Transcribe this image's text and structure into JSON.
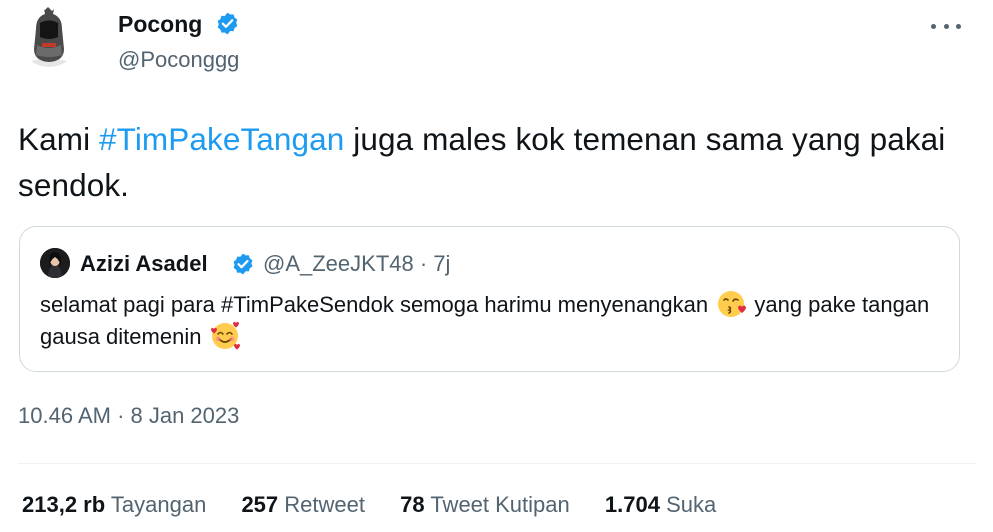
{
  "author": {
    "name": "Pocong",
    "handle": "@Poconggg",
    "avatar_icon": "pocong-avatar-icon",
    "verified_icon": "verified-badge-icon"
  },
  "menu": {
    "more_icon": "more-options-icon"
  },
  "tweet": {
    "text_before": "Kami ",
    "hashtag": "#TimPakeTangan",
    "text_after": " juga males kok temenan sama yang pakai sendok."
  },
  "quoted_tweet": {
    "name": "Azizi Asadel",
    "handle": "@A_ZeeJKT48 · 7j",
    "text_part1": "selamat pagi para #TimPakeSendok semoga harimu menyenangkan ",
    "text_part2": " yang pake tangan gausa ditemenin ",
    "emoji1": "face-blowing-kiss-emoji",
    "emoji2": "smiling-face-with-hearts-emoji"
  },
  "timestamp": "10.46 AM · 8 Jan 2023",
  "stats": [
    {
      "value": "213,2 rb",
      "label": "Tayangan"
    },
    {
      "value": "257",
      "label": "Retweet"
    },
    {
      "value": "78",
      "label": "Tweet Kutipan"
    },
    {
      "value": "1.704",
      "label": "Suka"
    }
  ],
  "colors": {
    "link": "#1d9bf0",
    "secondary_text": "#536471",
    "border": "#cfd9de",
    "verified": "#1d9bf0"
  }
}
